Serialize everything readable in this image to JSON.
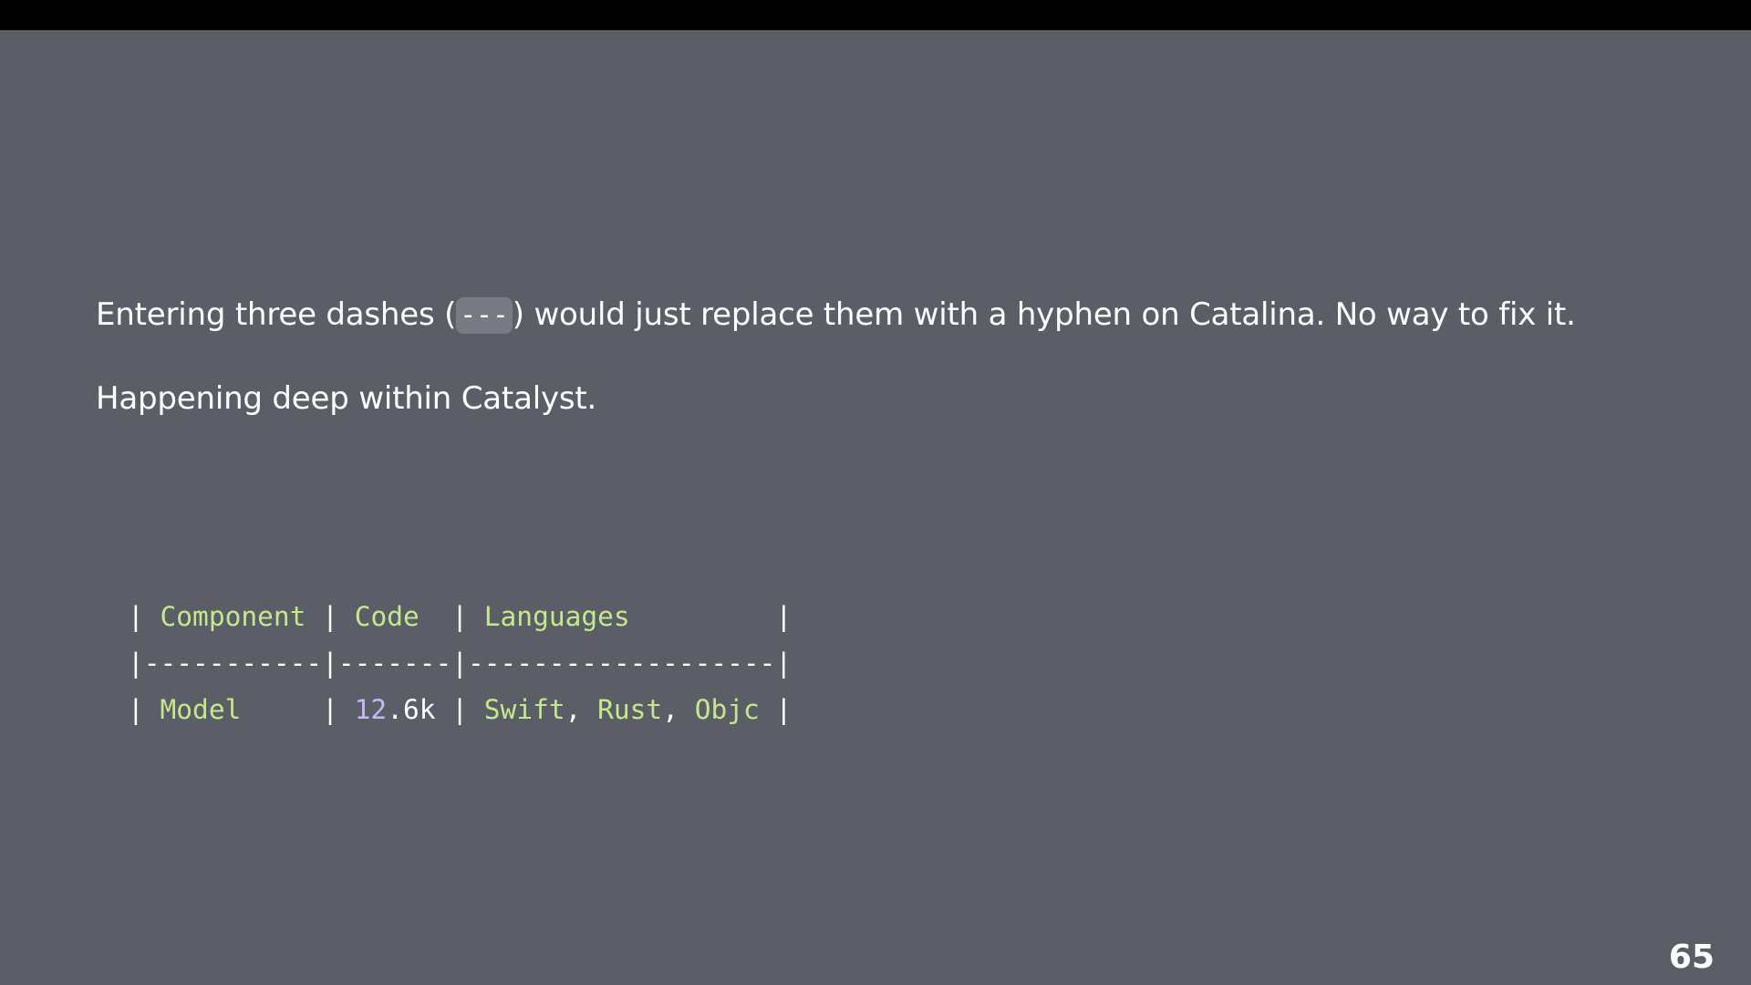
{
  "paragraph1": {
    "before": "Entering three dashes (",
    "code": "---",
    "after": ") would just replace them with a hyphen on Catalina. No way to fix it."
  },
  "paragraph2": "Happening deep within Catalyst.",
  "code_table": {
    "header": {
      "col1": "Component",
      "col2": "Code",
      "col3": "Languages"
    },
    "separator": "|-----------|-------|-------------------|",
    "row": {
      "component": "Model",
      "code_int": "12",
      "code_rest": ".6k",
      "lang1": "Swift",
      "lang2": "Rust",
      "lang3": "Objc"
    }
  },
  "page_number": "65",
  "colors": {
    "background": "#5b5e66",
    "code_green": "#c3e88d",
    "code_purple": "#c5b8f5",
    "inline_code_bg": "#767b84"
  }
}
